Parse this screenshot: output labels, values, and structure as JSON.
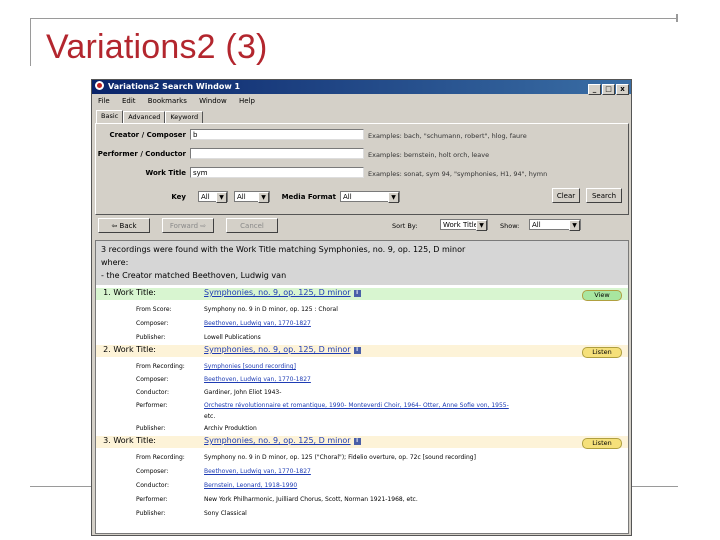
{
  "slide": {
    "title": "Variations2 (3)"
  },
  "window": {
    "title": "Variations2 Search Window 1",
    "controls": [
      "_",
      "□",
      "x"
    ],
    "menu": [
      "File",
      "Edit",
      "Bookmarks",
      "Window",
      "Help"
    ],
    "tabs": [
      "Basic",
      "Advanced",
      "Keyword"
    ],
    "form": {
      "creator_label": "Creator / Composer",
      "creator_value": "b",
      "creator_example": "Examples: bach, \"schumann, robert\", hlog, faure",
      "performer_label": "Performer / Conductor",
      "performer_value": "",
      "performer_example": "Examples: bernstein, holt orch, leave",
      "worktitle_label": "Work Title",
      "worktitle_value": "sym",
      "worktitle_example": "Examples: sonat, sym 94, \"symphonies, H1, 94\", hymn",
      "key_label": "Key",
      "key_value1": "All",
      "key_value2": "All",
      "media_label": "Media Format",
      "media_value": "All",
      "clear_label": "Clear",
      "search_label": "Search"
    },
    "nav": {
      "back_label": "⇦ Back",
      "forward_label": "Forward ⇨",
      "cancel_label": "Cancel",
      "sort_label": "Sort By:",
      "sort_value": "Work Title",
      "show_label": "Show:",
      "show_value": "All"
    },
    "results": {
      "summary_line1": "3 recordings were found with the Work Title matching Symphonies, no. 9, op. 125, D minor",
      "summary_line2": "where:",
      "summary_line3": "- the Creator matched Beethoven, Ludwig van",
      "items": [
        {
          "num": "1. Work Title:",
          "title": "Symphonies, no. 9, op. 125, D minor",
          "action": "View",
          "action_color": "#a8e6a0",
          "row_color": "#d8f5d0",
          "details": [
            {
              "label": "From Score:",
              "value": "Symphony no. 9 in D minor, op. 125 : Choral",
              "link": false
            },
            {
              "label": "Composer:",
              "value": "Beethoven, Ludwig van, 1770-1827",
              "link": true
            },
            {
              "label": "Publisher:",
              "value": "Lowell Publications",
              "link": false
            }
          ]
        },
        {
          "num": "2. Work Title:",
          "title": "Symphonies, no. 9, op. 125, D minor",
          "action": "Listen",
          "action_color": "#f5e07a",
          "row_color": "#fdf3d8",
          "details": [
            {
              "label": "From Recording:",
              "value": "Symphonies [sound recording]",
              "link": true
            },
            {
              "label": "Composer:",
              "value": "Beethoven, Ludwig van, 1770-1827",
              "link": true
            },
            {
              "label": "Conductor:",
              "value": "Gardiner, John Eliot 1943-",
              "link": false
            },
            {
              "label": "Performer:",
              "value": "Orchestre révolutionnaire et romantique, 1990-   Monteverdi Choir, 1964-   Otter, Anne Sofie von, 1955-",
              "link": false
            },
            {
              "label": "",
              "value": "etc.",
              "link": false
            },
            {
              "label": "Publisher:",
              "value": "Archiv Produktion",
              "link": false
            }
          ]
        },
        {
          "num": "3. Work Title:",
          "title": "Symphonies, no. 9, op. 125, D minor",
          "action": "Listen",
          "action_color": "#f5e07a",
          "row_color": "#fdf3d8",
          "details": [
            {
              "label": "From Recording:",
              "value": "Symphony no. 9 in D minor, op. 125 (\"Choral\"); Fidelio overture, op. 72c [sound recording]",
              "link": false
            },
            {
              "label": "Composer:",
              "value": "Beethoven, Ludwig van, 1770-1827",
              "link": true
            },
            {
              "label": "Conductor:",
              "value": "Bernstein, Leonard, 1918-1990",
              "link": true
            },
            {
              "label": "Performer:",
              "value": "New York Philharmonic,   Juilliard Chorus,   Scott, Norman 1921-1968,   etc.",
              "link": false
            },
            {
              "label": "Publisher:",
              "value": "Sony Classical",
              "link": false
            }
          ]
        }
      ]
    }
  }
}
